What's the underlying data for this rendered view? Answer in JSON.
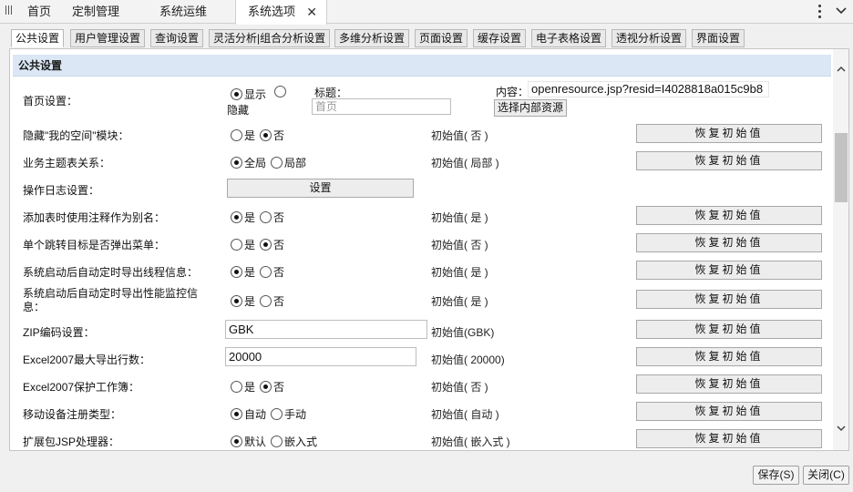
{
  "top_tabs": [
    "首页",
    "定制管理",
    "系统运维",
    "系统选项"
  ],
  "sub_tabs": [
    "公共设置",
    "用户管理设置",
    "查询设置",
    "灵活分析|组合分析设置",
    "多维分析设置",
    "页面设置",
    "缓存设置",
    "电子表格设置",
    "透视分析设置",
    "界面设置"
  ],
  "section_title": "公共设置",
  "homepage": {
    "label": "首页设置：",
    "opt_show": "显示",
    "opt_hide": "隐藏",
    "title_label": "标题：",
    "title_placeholder": "首页",
    "content_label": "内容：",
    "content_value": "openresource.jsp?resid=I4028818a015c9b8",
    "select_button": "选择内部资源"
  },
  "reset_label": "恢复初始值",
  "rows": {
    "hide_myspace": {
      "label": "隐藏\"我的空间\"模块：",
      "opt1": "是",
      "opt2": "否",
      "init": "初始值( 否 )"
    },
    "business_topic": {
      "label": "业务主题表关系：",
      "opt1": "全局",
      "opt2": "局部",
      "init": "初始值( 局部 )"
    },
    "oplog": {
      "label": "操作日志设置：",
      "button": "设置"
    },
    "comment_alias": {
      "label": "添加表时使用注释作为别名：",
      "opt1": "是",
      "opt2": "否",
      "init": "初始值( 是 )"
    },
    "jump_menu": {
      "label": "单个跳转目标是否弹出菜单：",
      "opt1": "是",
      "opt2": "否",
      "init": "初始值( 否 )"
    },
    "export_thread": {
      "label": "系统启动后自动定时导出线程信息：",
      "opt1": "是",
      "opt2": "否",
      "init": "初始值( 是 )"
    },
    "export_perf": {
      "label": "系统启动后自动定时导出性能监控信息：",
      "opt1": "是",
      "opt2": "否",
      "init": "初始值( 是 )"
    },
    "zip_encoding": {
      "label": "ZIP编码设置：",
      "value": "GBK",
      "init": "初始值(GBK)"
    },
    "excel_rows": {
      "label": "Excel2007最大导出行数：",
      "value": "20000",
      "init": "初始值( 20000)"
    },
    "excel_protect": {
      "label": "Excel2007保护工作簿：",
      "opt1": "是",
      "opt2": "否",
      "init": "初始值( 否 )"
    },
    "mobile_reg": {
      "label": "移动设备注册类型：",
      "opt1": "自动",
      "opt2": "手动",
      "init": "初始值( 自动 )"
    },
    "ext_jsp": {
      "label": "扩展包JSP处理器：",
      "opt1": "默认",
      "opt2": "嵌入式",
      "init": "初始值( 嵌入式 )"
    }
  },
  "footer": {
    "save": "保存(S)",
    "close": "关闭(C)"
  }
}
